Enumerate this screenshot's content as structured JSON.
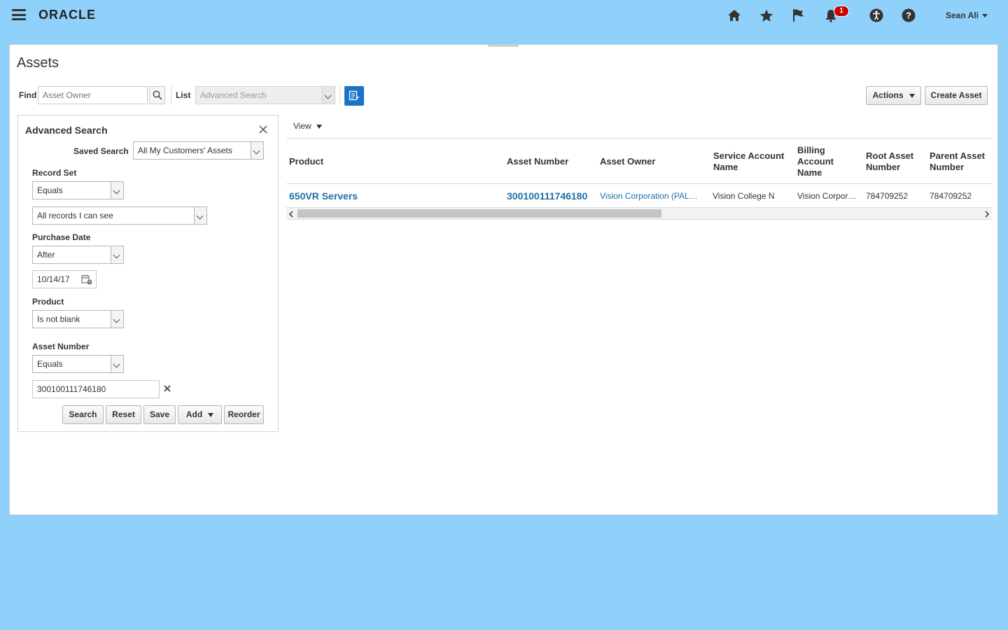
{
  "header": {
    "logo": "ORACLE",
    "notification_count": "1",
    "user_name": "Sean Ali"
  },
  "page": {
    "title": "Assets"
  },
  "toolbar": {
    "find_label": "Find",
    "find_placeholder": "Asset Owner",
    "list_label": "List",
    "list_value": "Advanced Search",
    "actions_label": "Actions",
    "create_label": "Create Asset"
  },
  "advanced_search": {
    "title": "Advanced Search",
    "saved_search_label": "Saved Search",
    "saved_search_value": "All My Customers' Assets",
    "record_set_label": "Record Set",
    "record_set_operator": "Equals",
    "record_set_value": "All records I can see",
    "purchase_date_label": "Purchase Date",
    "purchase_date_operator": "After",
    "purchase_date_value": "10/14/17",
    "product_label": "Product",
    "product_operator": "Is not blank",
    "asset_number_label": "Asset Number",
    "asset_number_operator": "Equals",
    "asset_number_value": "300100111746180",
    "buttons": {
      "search": "Search",
      "reset": "Reset",
      "save": "Save",
      "add": "Add",
      "reorder": "Reorder"
    }
  },
  "results": {
    "view_label": "View",
    "columns": [
      "Product",
      "Asset Number",
      "Asset Owner",
      "Service Account Name",
      "Billing Account Name",
      "Root Asset Number",
      "Parent Asset Number"
    ],
    "rows": [
      {
        "product": "650VR Servers",
        "asset_number": "300100111746180",
        "asset_owner": "Vision Corporation (PALO ALTO)",
        "service_account": "Vision College N",
        "billing_account": "Vision Corporation",
        "root_asset": "784709252",
        "parent_asset": "784709252"
      }
    ]
  },
  "colors": {
    "background": "#8fd1fa",
    "link": "#1f6ea9",
    "accent_button": "#1a73c9",
    "badge": "#cc0000"
  }
}
